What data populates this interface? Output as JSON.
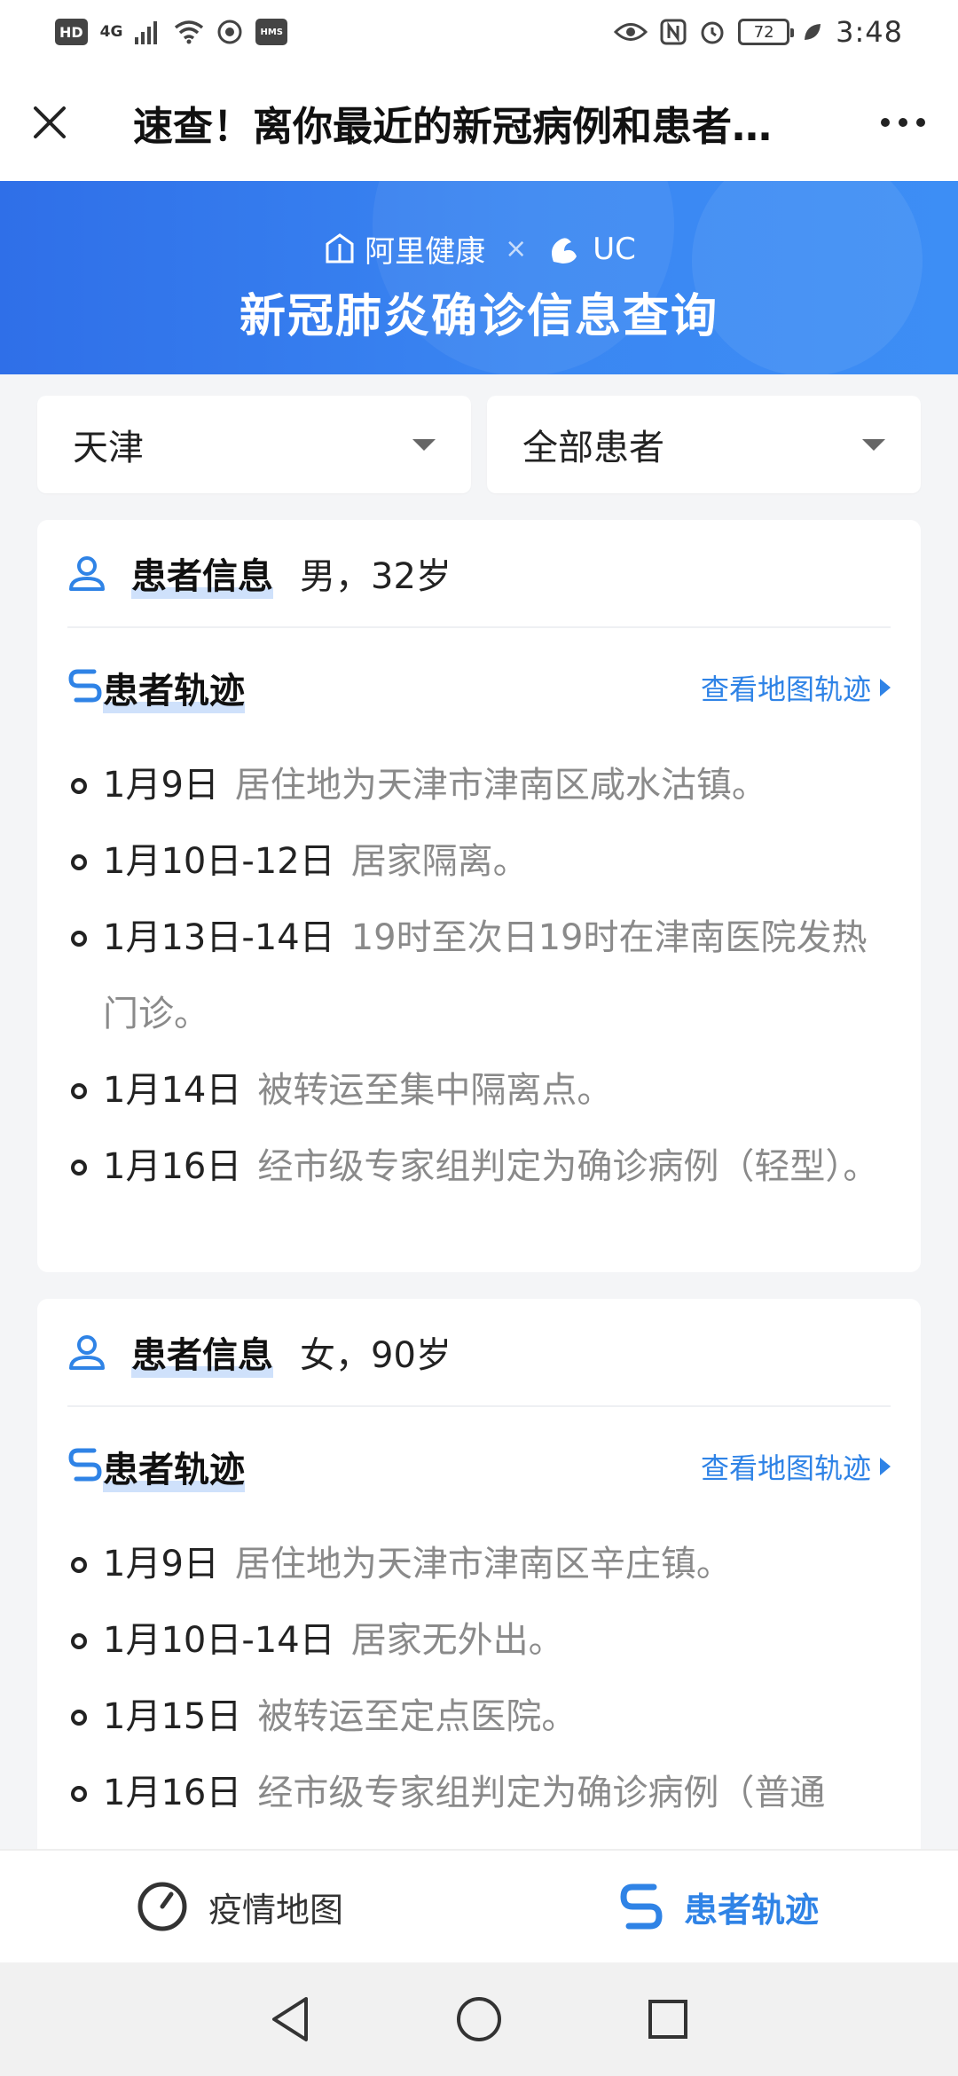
{
  "status_bar": {
    "hd": "HD",
    "net": "4G",
    "hms": "HMS",
    "battery": "72",
    "time": "3:48"
  },
  "title_bar": {
    "title": "速查！离你最近的新冠病例和患者…"
  },
  "banner": {
    "brand1": "阿里健康",
    "separator": "×",
    "brand2": "UC",
    "title": "新冠肺炎确诊信息查询"
  },
  "filters": {
    "city": "天津",
    "patient_scope": "全部患者"
  },
  "cards": [
    {
      "info_label": "患者信息",
      "info_value": "男，32岁",
      "track_label": "患者轨迹",
      "map_link": "查看地图轨迹",
      "events": [
        {
          "date": "1月9日",
          "desc": "居住地为天津市津南区咸水沽镇。"
        },
        {
          "date": "1月10日-12日",
          "desc": "居家隔离。"
        },
        {
          "date": "1月13日-14日",
          "desc": "19时至次日19时在津南医院发热门诊。"
        },
        {
          "date": "1月14日",
          "desc": "被转运至集中隔离点。"
        },
        {
          "date": "1月16日",
          "desc": "经市级专家组判定为确诊病例（轻型）。"
        }
      ]
    },
    {
      "info_label": "患者信息",
      "info_value": "女，90岁",
      "track_label": "患者轨迹",
      "map_link": "查看地图轨迹",
      "events": [
        {
          "date": "1月9日",
          "desc": "居住地为天津市津南区辛庄镇。"
        },
        {
          "date": "1月10日-14日",
          "desc": "居家无外出。"
        },
        {
          "date": "1月15日",
          "desc": "被转运至定点医院。"
        },
        {
          "date": "1月16日",
          "desc": "经市级专家组判定为确诊病例（普通型）。"
        }
      ]
    }
  ],
  "tabs": {
    "map": "疫情地图",
    "track": "患者轨迹"
  },
  "colors": {
    "accent": "#2f83e6",
    "banner": "#3a86f2",
    "muted_text": "#8a8a8a"
  }
}
